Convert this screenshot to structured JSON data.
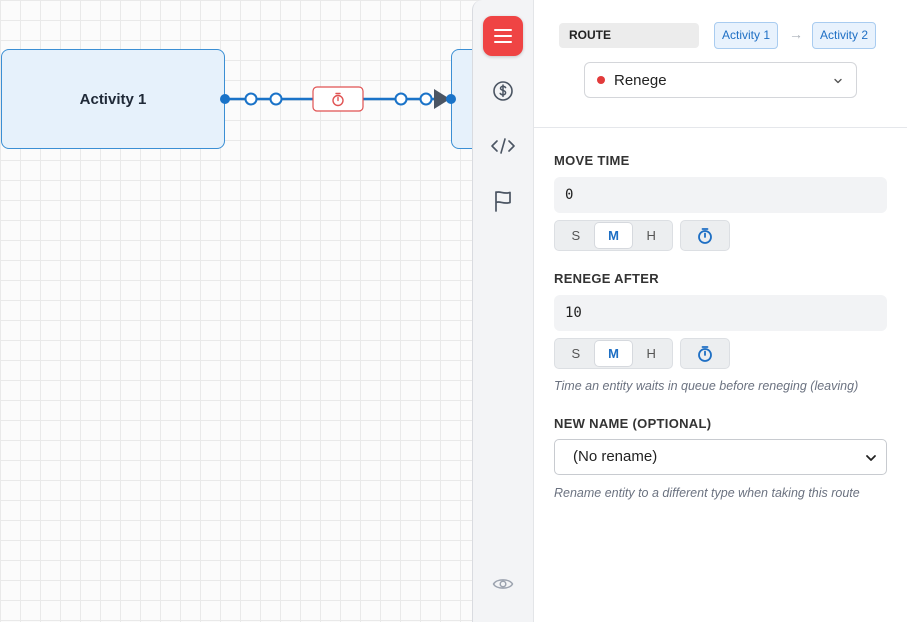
{
  "canvas": {
    "nodes": [
      {
        "label": "Activity 1"
      },
      {
        "label": ""
      }
    ]
  },
  "rail": {
    "items": [
      {
        "icon": "menu-icon",
        "active": true
      },
      {
        "icon": "dollar-icon",
        "active": false
      },
      {
        "icon": "code-icon",
        "active": false
      },
      {
        "icon": "flag-icon",
        "active": false
      },
      {
        "icon": "eye-icon",
        "active": false
      }
    ]
  },
  "panel": {
    "badge": "ROUTE",
    "from": "Activity 1",
    "to": "Activity 2",
    "arrow": "→",
    "route_type": {
      "value": "Renege",
      "color": "#e23b3b"
    },
    "move_time": {
      "label": "MOVE TIME",
      "value": "0",
      "units": [
        "S",
        "M",
        "H"
      ],
      "selected_unit": "M"
    },
    "renege_after": {
      "label": "RENEGE AFTER",
      "value": "10",
      "units": [
        "S",
        "M",
        "H"
      ],
      "selected_unit": "M",
      "hint": "Time an entity waits in queue before reneging (leaving)"
    },
    "new_name": {
      "label": "NEW NAME (OPTIONAL)",
      "value": "(No rename)",
      "hint": "Rename entity to a different type when taking this route"
    }
  },
  "colors": {
    "accent": "#ef4444",
    "link": "#1e6fc4",
    "edge": "#1a73c8",
    "node_fill": "#e6f1fb"
  }
}
